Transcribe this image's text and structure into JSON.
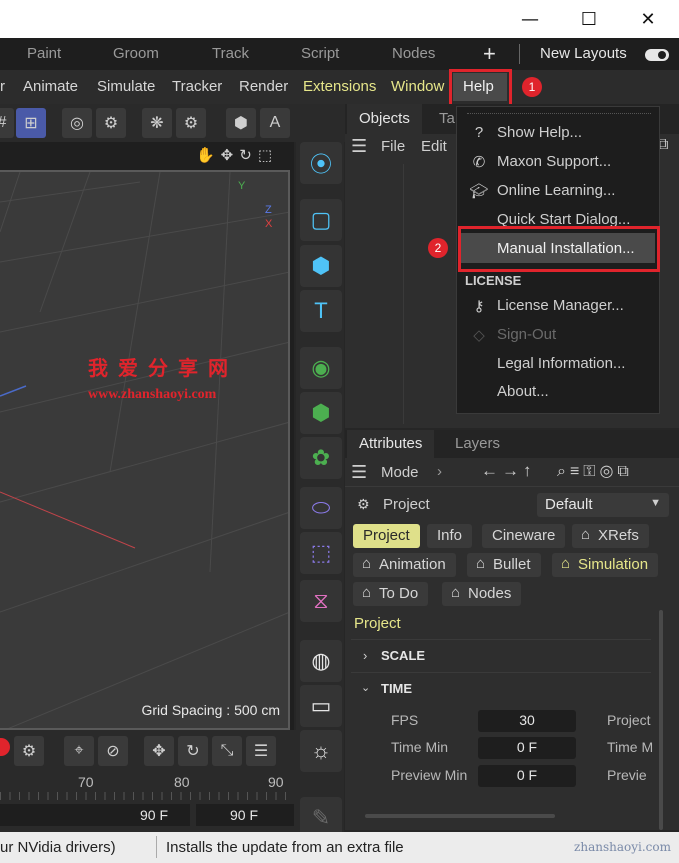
{
  "window_controls": {
    "minimize": "—",
    "maximize": "☐",
    "close": "✕"
  },
  "layout_tabs": [
    "Paint",
    "Groom",
    "Track",
    "Script",
    "Nodes"
  ],
  "layout_add": "+",
  "new_layouts_label": "New Layouts",
  "menubar": {
    "items": [
      "r",
      "Animate",
      "Simulate",
      "Tracker",
      "Render",
      "Extensions",
      "Window",
      "Help"
    ],
    "badge1": "1"
  },
  "objects_panel": {
    "tabs": [
      "Objects",
      "Ta"
    ],
    "menu": [
      "File",
      "Edit"
    ]
  },
  "help_menu": {
    "items": [
      {
        "label": "Show Help...",
        "icon": "question-icon"
      },
      {
        "label": "Maxon Support...",
        "icon": "phone-icon"
      },
      {
        "label": "Online Learning...",
        "icon": "graduation-cap-icon"
      },
      {
        "label": "Quick Start Dialog..."
      },
      {
        "label": "Manual Installation..."
      }
    ],
    "section": "LICENSE",
    "license_items": [
      {
        "label": "License Manager...",
        "icon": "key-icon"
      },
      {
        "label": "Sign-Out",
        "icon": "signout-icon",
        "disabled": true
      },
      {
        "label": "Legal Information..."
      },
      {
        "label": "About..."
      }
    ],
    "badge2": "2"
  },
  "viewport": {
    "grid_spacing": "Grid Spacing : 500 cm",
    "axis_y": "Y",
    "axis_z": "Z",
    "axis_x": "X"
  },
  "watermark": {
    "cn": "我爱分享网",
    "url": "www.zhanshaoyi.com",
    "corner": "zhanshaoyi.com"
  },
  "attributes": {
    "tabs": [
      "Attributes",
      "Layers"
    ],
    "mode_label": "Mode",
    "object_label": "Project",
    "preset": "Default",
    "chips_row1": [
      "Project",
      "Info",
      "Cineware",
      "XRefs"
    ],
    "chips_row2": [
      "Animation",
      "Bullet",
      "Simulation"
    ],
    "chips_row3": [
      "To Do",
      "Nodes"
    ],
    "section_title": "Project",
    "group_scale": "SCALE",
    "group_time": "TIME",
    "fields": [
      {
        "label": "FPS",
        "value": "30",
        "right": "Project"
      },
      {
        "label": "Time Min",
        "value": "0 F",
        "right": "Time M"
      },
      {
        "label": "Preview Min",
        "value": "0 F",
        "right": "Previe"
      }
    ]
  },
  "timeline": {
    "ticks": [
      "70",
      "80",
      "90"
    ],
    "end_frame": "90 F",
    "end_frame2": "90 F"
  },
  "statusbar": {
    "left": "ur NVidia drivers)",
    "right": "Installs the update from an extra file"
  },
  "colors": {
    "accent_yellow": "#dfe08a",
    "annotation_red": "#e0242c",
    "icon_blue": "#4fc3f7",
    "icon_green": "#4caf50"
  }
}
